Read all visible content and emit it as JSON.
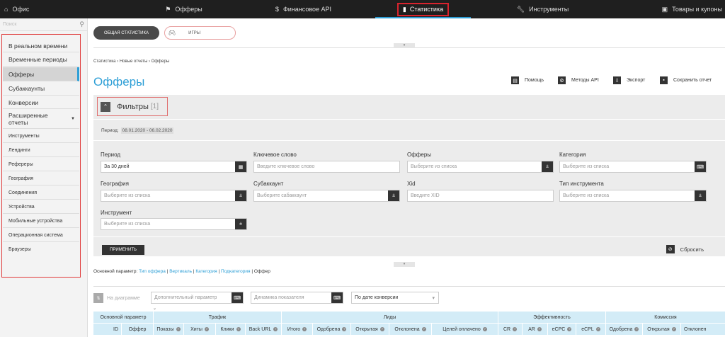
{
  "topnav": {
    "items": [
      {
        "label": "Офис",
        "icon": "home-icon"
      },
      {
        "label": "Офферы",
        "icon": "flag-icon"
      },
      {
        "label": "Финансовое API",
        "icon": "dollar-icon"
      },
      {
        "label": "Статистика",
        "icon": "bar-chart-icon"
      },
      {
        "label": "Инструменты",
        "icon": "wrench-icon"
      },
      {
        "label": "Товары и купоны",
        "icon": "coupon-icon"
      }
    ],
    "active_index": 3
  },
  "sidebar": {
    "search_placeholder": "Поиск",
    "items": [
      "В реальном времени",
      "Временные периоды",
      "Офферы",
      "Субаккаунты",
      "Конверсии",
      "Расширенные отчеты",
      "Инструменты",
      "Лендинги",
      "Рефереры",
      "География",
      "Соединения",
      "Устройства",
      "Мобильные устройства",
      "Операционная система",
      "Браузеры"
    ],
    "active_index": 2
  },
  "pills": {
    "general": "ОБЩАЯ СТАТИСТИКА",
    "games": "ИГРЫ"
  },
  "breadcrumb": "Статистика › Новые отчеты › Офферы",
  "page_title": "Офферы",
  "tools": {
    "help": "Помощь",
    "api": "Методы API",
    "export": "Экспорт",
    "save": "Сохранить отчет"
  },
  "filters": {
    "title": "Фильтры",
    "count": "[1]",
    "period_label": "Период:",
    "period_value": "08.01.2020 - 06.02.2020",
    "fields": {
      "period": {
        "label": "Период",
        "value": "За 30 дней"
      },
      "keyword": {
        "label": "Ключевое слово",
        "placeholder": "Введите ключевое слово"
      },
      "offers": {
        "label": "Офферы",
        "placeholder": "Выберите из списка"
      },
      "category": {
        "label": "Категория",
        "placeholder": "Выберите из списка"
      },
      "geo": {
        "label": "География",
        "placeholder": "Выберите из списка"
      },
      "subaccount": {
        "label": "Субаккаунт",
        "placeholder": "Выберите сабаккаунт"
      },
      "xid": {
        "label": "Xid",
        "placeholder": "Введите XID"
      },
      "tooltype": {
        "label": "Тип инструмента",
        "placeholder": "Выберите из списка"
      },
      "tool": {
        "label": "Инструмент",
        "placeholder": "Выберите из списка"
      }
    },
    "apply": "ПРИМЕНИТЬ",
    "reset": "Сбросить"
  },
  "params": {
    "label": "Основной параметр:",
    "links": [
      "Тип оффера",
      "Вертикаль",
      "Категория",
      "Подкатегория"
    ],
    "current": "Оффер"
  },
  "chart_controls": {
    "on_chart": "На диаграмме",
    "extra_param": "Дополнительный параметр",
    "dynamics": "Динамика показателя",
    "by_date": "По дате конверсии"
  },
  "table": {
    "groups": [
      "Основной параметр",
      "Трафик",
      "Лиды",
      "Эффективность",
      "Комиссия"
    ],
    "columns": [
      "ID",
      "Оффер",
      "Показы",
      "Хиты",
      "Клики",
      "Back URL",
      "Итого",
      "Одобрена",
      "Открытая",
      "Отклонена",
      "Целей оплачено",
      "CR",
      "AR",
      "eCPC",
      "eCPL",
      "Одобрена",
      "Открытая",
      "Отклонен"
    ]
  }
}
